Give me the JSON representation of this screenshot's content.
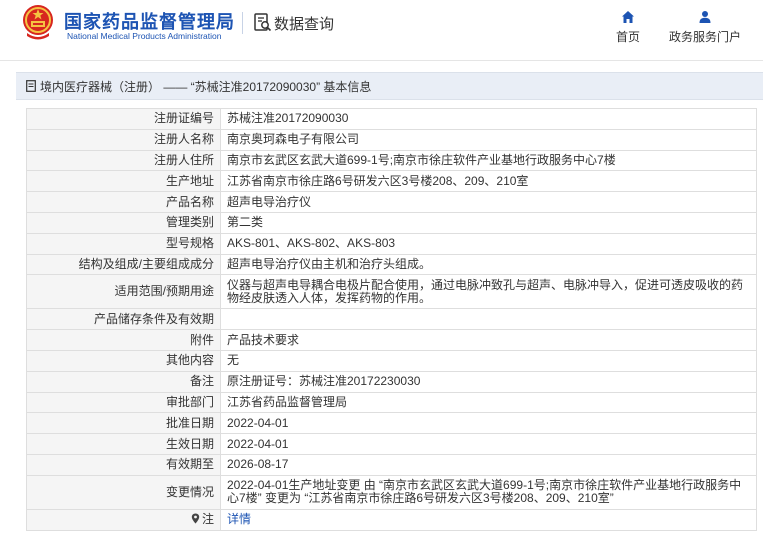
{
  "header": {
    "logo_cn": "国家药品监督管理局",
    "logo_en": "National Medical Products Administration",
    "section": "数据查询",
    "nav": [
      {
        "label": "首页",
        "icon": "home-icon"
      },
      {
        "label": "政务服务门户",
        "icon": "user-icon"
      }
    ]
  },
  "title": "境内医疗器械（注册） —— “苏械注准20172090030” 基本信息",
  "colors": {
    "brand": "#1d54b3",
    "emblem_red": "#d7261f",
    "emblem_gold": "#f5c242"
  },
  "rows": [
    {
      "key": "注册证编号",
      "value": "苏械注准20172090030"
    },
    {
      "key": "注册人名称",
      "value": "南京奥珂森电子有限公司"
    },
    {
      "key": "注册人住所",
      "value": "南京市玄武区玄武大道699-1号;南京市徐庄软件产业基地行政服务中心7楼"
    },
    {
      "key": "生产地址",
      "value": "江苏省南京市徐庄路6号研发六区3号楼208、209、210室"
    },
    {
      "key": "产品名称",
      "value": "超声电导治疗仪"
    },
    {
      "key": "管理类别",
      "value": "第二类"
    },
    {
      "key": "型号规格",
      "value": "AKS-801、AKS-802、AKS-803"
    },
    {
      "key": "结构及组成/主要组成成分",
      "value": "超声电导治疗仪由主机和治疗头组成。"
    },
    {
      "key": "适用范围/预期用途",
      "value": "仪器与超声电导耦合电极片配合使用，通过电脉冲致孔与超声、电脉冲导入，促进可透皮吸收的药物经皮肤透入人体，发挥药物的作用。"
    },
    {
      "key": "产品储存条件及有效期",
      "value": ""
    },
    {
      "key": "附件",
      "value": "产品技术要求"
    },
    {
      "key": "其他内容",
      "value": "无"
    },
    {
      "key": "备注",
      "value": "原注册证号：苏械注准20172230030"
    },
    {
      "key": "审批部门",
      "value": "江苏省药品监督管理局"
    },
    {
      "key": "批准日期",
      "value": "2022-04-01"
    },
    {
      "key": "生效日期",
      "value": "2022-04-01"
    },
    {
      "key": "有效期至",
      "value": "2026-08-17"
    },
    {
      "key": "变更情况",
      "value": "2022-04-01生产地址变更 由 “南京市玄武区玄武大道699-1号;南京市徐庄软件产业基地行政服务中心7楼” 变更为 “江苏省南京市徐庄路6号研发六区3号楼208、209、210室”"
    }
  ],
  "note": {
    "key": "注",
    "link": "详情"
  }
}
